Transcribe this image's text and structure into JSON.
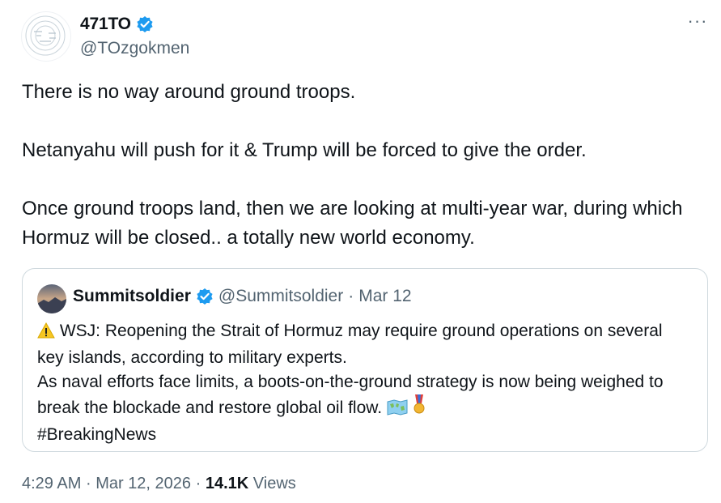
{
  "author": {
    "display_name": "471TO",
    "handle": "@TOzgokmen",
    "verified": true
  },
  "tweet": {
    "paragraphs": [
      "There is no way around ground troops.",
      "Netanyahu will push for it & Trump will be forced to give the order.",
      "Once ground troops land, then we are looking at multi-year war, during which Hormuz will be closed.. a totally new world economy."
    ]
  },
  "quote": {
    "display_name": "Summitsoldier",
    "handle": "@Summitsoldier",
    "separator": "·",
    "date": "Mar 12",
    "verified": true,
    "lines": [
      "WSJ: Reopening the Strait of Hormuz may require ground operations on several key islands, according to military experts.",
      "As naval efforts face limits, a boots-on-the-ground strategy is now being weighed to break the blockade and restore global oil flow.",
      "#BreakingNews"
    ],
    "icons": [
      "warning-icon",
      "world-map-icon",
      "military-medal-icon"
    ]
  },
  "footer": {
    "time": "4:29 AM",
    "separator": "·",
    "date": "Mar 12, 2026",
    "views_count": "14.1K",
    "views_label": "Views"
  },
  "colors": {
    "text": "#0f1419",
    "secondary": "#536471",
    "verified_blue": "#1d9bf0",
    "border": "#cfd9de"
  }
}
